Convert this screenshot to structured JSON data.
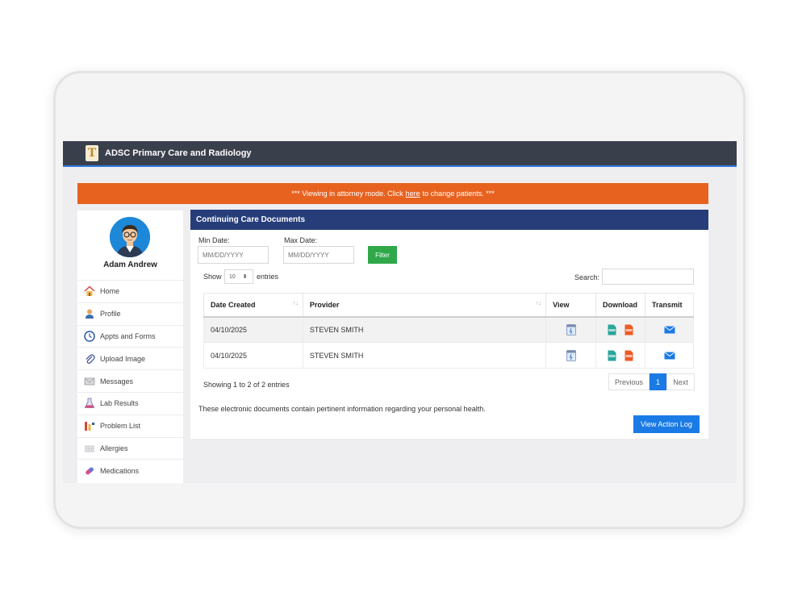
{
  "app": {
    "title": "ADSC Primary Care and Radiology",
    "logo_letter": "T"
  },
  "banner": {
    "prefix": "*** Viewing in attorney mode. Click",
    "link": "here",
    "suffix": "to change patients. ***"
  },
  "user": {
    "name": "Adam Andrew"
  },
  "sidebar": {
    "items": [
      {
        "label": "Home",
        "icon": "home-icon"
      },
      {
        "label": "Profile",
        "icon": "profile-icon"
      },
      {
        "label": "Appts and Forms",
        "icon": "clock-icon"
      },
      {
        "label": "Upload Image",
        "icon": "paperclip-icon"
      },
      {
        "label": "Messages",
        "icon": "envelope-icon"
      },
      {
        "label": "Lab Results",
        "icon": "flask-icon"
      },
      {
        "label": "Problem List",
        "icon": "chart-bars-icon"
      },
      {
        "label": "Allergies",
        "icon": "allergy-icon"
      },
      {
        "label": "Medications",
        "icon": "pill-icon"
      }
    ]
  },
  "panel": {
    "title": "Continuing Care Documents",
    "min_date_label": "Min Date:",
    "max_date_label": "Max Date:",
    "date_placeholder": "MM/DD/YYYY",
    "filter_label": "Filter",
    "show_label": "Show",
    "entries_value": "10",
    "entries_label": "entries",
    "search_label": "Search:",
    "columns": [
      "Date Created",
      "Provider",
      "View",
      "Download",
      "Transmit"
    ],
    "rows": [
      {
        "date": "04/10/2025",
        "provider": "STEVEN SMITH"
      },
      {
        "date": "04/10/2025",
        "provider": "STEVEN SMITH"
      }
    ],
    "showing_text": "Showing 1 to 2 of 2 entries",
    "pager": {
      "previous": "Previous",
      "page": "1",
      "next": "Next"
    },
    "footnote": "These electronic documents contain pertinent information regarding your personal health.",
    "action_log_label": "View Action Log"
  },
  "colors": {
    "topbar": "#3a3f4c",
    "banner": "#e8621f",
    "panel_header": "#273d7a",
    "accent": "#1a7be6",
    "filter": "#2fa84a"
  }
}
